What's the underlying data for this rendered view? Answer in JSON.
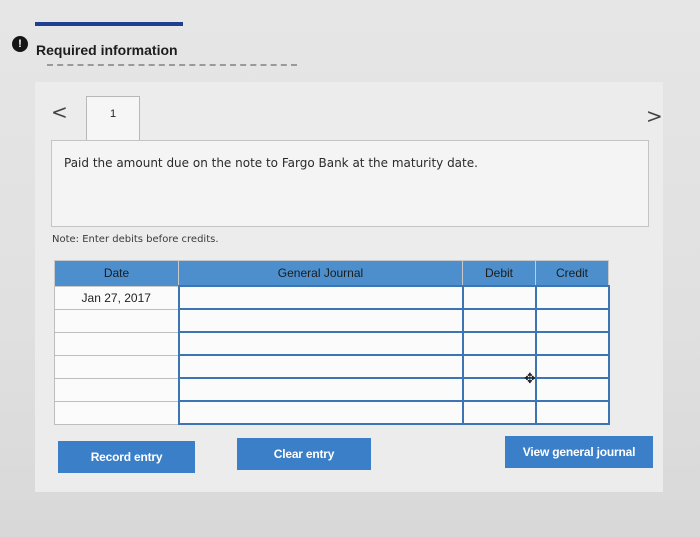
{
  "header": {
    "alert_icon": "!",
    "title": "Required information"
  },
  "pager": {
    "prev_icon": "<",
    "next_icon": ">",
    "tab_label": "1"
  },
  "prompt": {
    "text": "Paid the amount due on the note to Fargo Bank at the maturity date."
  },
  "note": "Note: Enter debits before credits.",
  "journal": {
    "columns": [
      "Date",
      "General Journal",
      "Debit",
      "Credit"
    ],
    "rows": [
      {
        "date": "Jan 27, 2017",
        "account": "",
        "debit": "",
        "credit": ""
      },
      {
        "date": "",
        "account": "",
        "debit": "",
        "credit": ""
      },
      {
        "date": "",
        "account": "",
        "debit": "",
        "credit": ""
      },
      {
        "date": "",
        "account": "",
        "debit": "",
        "credit": ""
      },
      {
        "date": "",
        "account": "",
        "debit": "",
        "credit": ""
      },
      {
        "date": "",
        "account": "",
        "debit": "",
        "credit": ""
      }
    ]
  },
  "buttons": {
    "record": "Record entry",
    "clear": "Clear entry",
    "view": "View general journal"
  },
  "colors": {
    "header_blue": "#4d8fcc",
    "button_blue": "#3b7fc9",
    "border_blue": "#3c74b4"
  }
}
